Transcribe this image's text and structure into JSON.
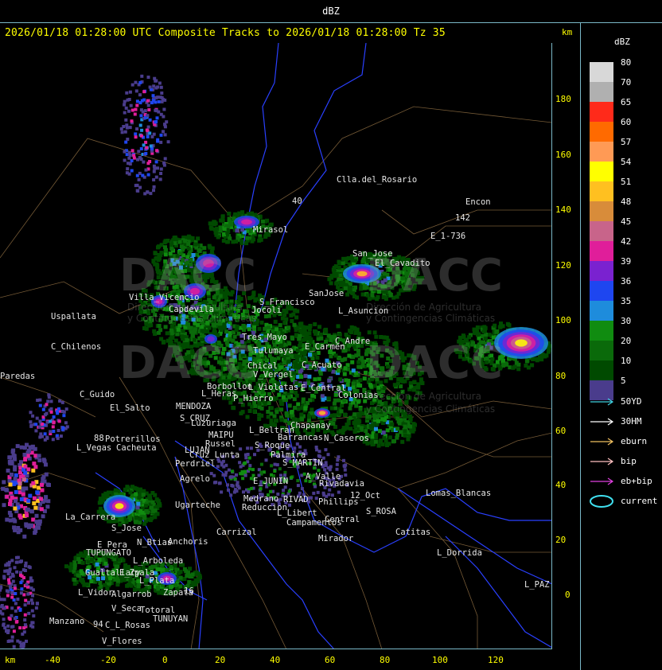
{
  "title": "dBZ",
  "header": {
    "text": "2026/01/18 01:28:00 UTC Composite Tracks to 2026/01/18 01:28:00 Tz 35",
    "km_label": "km"
  },
  "axes": {
    "x_label": "km",
    "x_ticks": [
      "-40",
      "-20",
      "0",
      "20",
      "40",
      "60",
      "80",
      "100",
      "120"
    ],
    "y_ticks": [
      "180",
      "160",
      "140",
      "120",
      "100",
      "80",
      "60",
      "40",
      "20",
      "0"
    ]
  },
  "legend": {
    "title": "dBZ",
    "levels": [
      {
        "label": "80",
        "color": "#d8d8d8"
      },
      {
        "label": "70",
        "color": "#b0b0b0"
      },
      {
        "label": "65",
        "color": "#ff2a1a"
      },
      {
        "label": "60",
        "color": "#ff6a00"
      },
      {
        "label": "57",
        "color": "#ff9a55"
      },
      {
        "label": "54",
        "color": "#ffff00"
      },
      {
        "label": "51",
        "color": "#ffc020"
      },
      {
        "label": "48",
        "color": "#d88c3a"
      },
      {
        "label": "45",
        "color": "#c8648a"
      },
      {
        "label": "42",
        "color": "#e01e9a"
      },
      {
        "label": "39",
        "color": "#7a22d0"
      },
      {
        "label": "36",
        "color": "#1e46f0"
      },
      {
        "label": "35",
        "color": "#1e8cdc"
      },
      {
        "label": "30",
        "color": "#108c10"
      },
      {
        "label": "20",
        "color": "#0a6a0a"
      },
      {
        "label": "10",
        "color": "#004a00"
      },
      {
        "label": "5",
        "color": "#4a3c8c"
      }
    ],
    "tracks": [
      {
        "label": "50YD",
        "color": "#40d0e0",
        "kind": "arrow"
      },
      {
        "label": "30HM",
        "color": "#ffffff",
        "kind": "arrow"
      },
      {
        "label": "eburn",
        "color": "#f0c060",
        "kind": "arrow"
      },
      {
        "label": "bip",
        "color": "#ffc0c0",
        "kind": "arrow"
      },
      {
        "label": "eb+bip",
        "color": "#e040e0",
        "kind": "arrow"
      },
      {
        "label": "current",
        "color": "#40e0f0",
        "kind": "ellipse"
      }
    ]
  },
  "watermark": {
    "brand": "DACC",
    "line1": "Dirección de Agricultura",
    "line2": "y Contingencias Climáticas"
  },
  "cities": [
    {
      "name": "Clla.del_Rosario"
    },
    {
      "name": "Encon"
    },
    {
      "name": "E_1-736"
    },
    {
      "name": "142"
    },
    {
      "name": "San_Jose"
    },
    {
      "name": "El_Cavadito"
    },
    {
      "name": "Mirasol"
    },
    {
      "name": "Villa_Vicencio"
    },
    {
      "name": "Capdevila"
    },
    {
      "name": "S_Francisco"
    },
    {
      "name": "Jocoli"
    },
    {
      "name": "SanJose"
    },
    {
      "name": "L_Asuncion"
    },
    {
      "name": "Uspallata"
    },
    {
      "name": "C_Chilenos"
    },
    {
      "name": "Tres_Mayo"
    },
    {
      "name": "Tulumaya"
    },
    {
      "name": "E_Carmen"
    },
    {
      "name": "C_Andre"
    },
    {
      "name": "Chical"
    },
    {
      "name": "V_Vergel"
    },
    {
      "name": "C_Acuato"
    },
    {
      "name": "Paredas"
    },
    {
      "name": "C_Guido"
    },
    {
      "name": "El_Salto"
    },
    {
      "name": "L_Heras"
    },
    {
      "name": "P_Hierro"
    },
    {
      "name": "Borbollon"
    },
    {
      "name": "L_Violetas"
    },
    {
      "name": "E_Central"
    },
    {
      "name": "Colonias"
    },
    {
      "name": "MENDOZA"
    },
    {
      "name": "S_CRUZ"
    },
    {
      "name": "Luzuriaga"
    },
    {
      "name": "L_Beltran"
    },
    {
      "name": "Chapanay"
    },
    {
      "name": "MAIPU"
    },
    {
      "name": "Russel"
    },
    {
      "name": "Barrancas"
    },
    {
      "name": "N_Caseros"
    },
    {
      "name": "Potrerillos"
    },
    {
      "name": "L_Vegas"
    },
    {
      "name": "Cacheuta"
    },
    {
      "name": "LUJAN"
    },
    {
      "name": "Cruz_Lunta"
    },
    {
      "name": "S_Roque"
    },
    {
      "name": "Palmira"
    },
    {
      "name": "Perdriel"
    },
    {
      "name": "S_MARTIN"
    },
    {
      "name": "Agrelo"
    },
    {
      "name": "A_Valle"
    },
    {
      "name": "Rivadavia"
    },
    {
      "name": "E_JUNIN"
    },
    {
      "name": "12_Oct"
    },
    {
      "name": "Lomas_Blancas"
    },
    {
      "name": "La_Carrera"
    },
    {
      "name": "Ugarteche"
    },
    {
      "name": "Medrano"
    },
    {
      "name": "RIVAD"
    },
    {
      "name": "Phillips"
    },
    {
      "name": "S_ROSA"
    },
    {
      "name": "S_Jose"
    },
    {
      "name": "Reduccion"
    },
    {
      "name": "L_Libert"
    },
    {
      "name": "Central"
    },
    {
      "name": "Carrizal"
    },
    {
      "name": "Campamentos"
    },
    {
      "name": "Catitas"
    },
    {
      "name": "E_Pera"
    },
    {
      "name": "N_Btias"
    },
    {
      "name": "Anchoris"
    },
    {
      "name": "Mirador"
    },
    {
      "name": "TUPUNGATO"
    },
    {
      "name": "L_Dorrida"
    },
    {
      "name": "L_Arboleda"
    },
    {
      "name": "Gualtallary"
    },
    {
      "name": "E_Zpala"
    },
    {
      "name": "L_Plata"
    },
    {
      "name": "L_Vidor"
    },
    {
      "name": "Algarrob"
    },
    {
      "name": "Zapata"
    },
    {
      "name": "V_Seca"
    },
    {
      "name": "Totoral"
    },
    {
      "name": "TUNUYAN"
    },
    {
      "name": "Manzano"
    },
    {
      "name": "94"
    },
    {
      "name": "C_L_Rosas"
    },
    {
      "name": "V_Flores"
    },
    {
      "name": "L_PAZ"
    },
    {
      "name": "40"
    },
    {
      "name": "88"
    },
    {
      "name": "16"
    }
  ]
}
